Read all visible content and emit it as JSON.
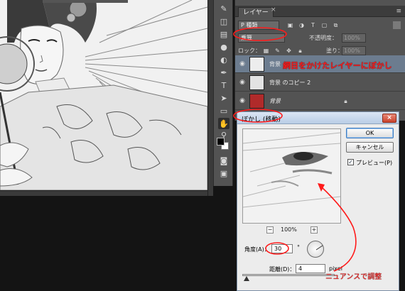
{
  "layers_panel": {
    "tab_label": "レイヤー",
    "tab_close": "×",
    "filter_kind_label": "P 種類",
    "blend_mode": "乗算",
    "opacity_label": "不透明度：",
    "opacity_value": "100%",
    "lock_label": "ロック：",
    "fill_label": "塗り：",
    "fill_value": "100%",
    "filter_icons": [
      "image-filter-icon",
      "adjustment-filter-icon",
      "type-filter-icon",
      "shape-filter-icon",
      "smart-object-filter-icon"
    ],
    "layers": [
      {
        "name": "背景",
        "selected": true
      },
      {
        "name": "背景 のコピー 2",
        "selected": false
      },
      {
        "name": "背景",
        "selected": false,
        "italic": true
      }
    ]
  },
  "annotations": {
    "layer_note": "網目をかけたレイヤーにぼかし",
    "nuance_note": "ニュアンスで調整"
  },
  "dialog": {
    "title": "ぼかし (移動)",
    "ok": "OK",
    "cancel": "キャンセル",
    "preview_label": "プレビュー(P)",
    "preview_checked": true,
    "zoom_out": "−",
    "zoom_in": "+",
    "zoom": "100%",
    "angle_label": "角度(A)：",
    "angle_value": "30",
    "angle_unit": "°",
    "distance_label": "距離(D)：",
    "distance_value": "4",
    "distance_unit": "pixel"
  },
  "colors": {
    "annotation_red": "#ff1a1a",
    "selected_layer": "#6c7c8f",
    "panel_bg": "#535353"
  }
}
